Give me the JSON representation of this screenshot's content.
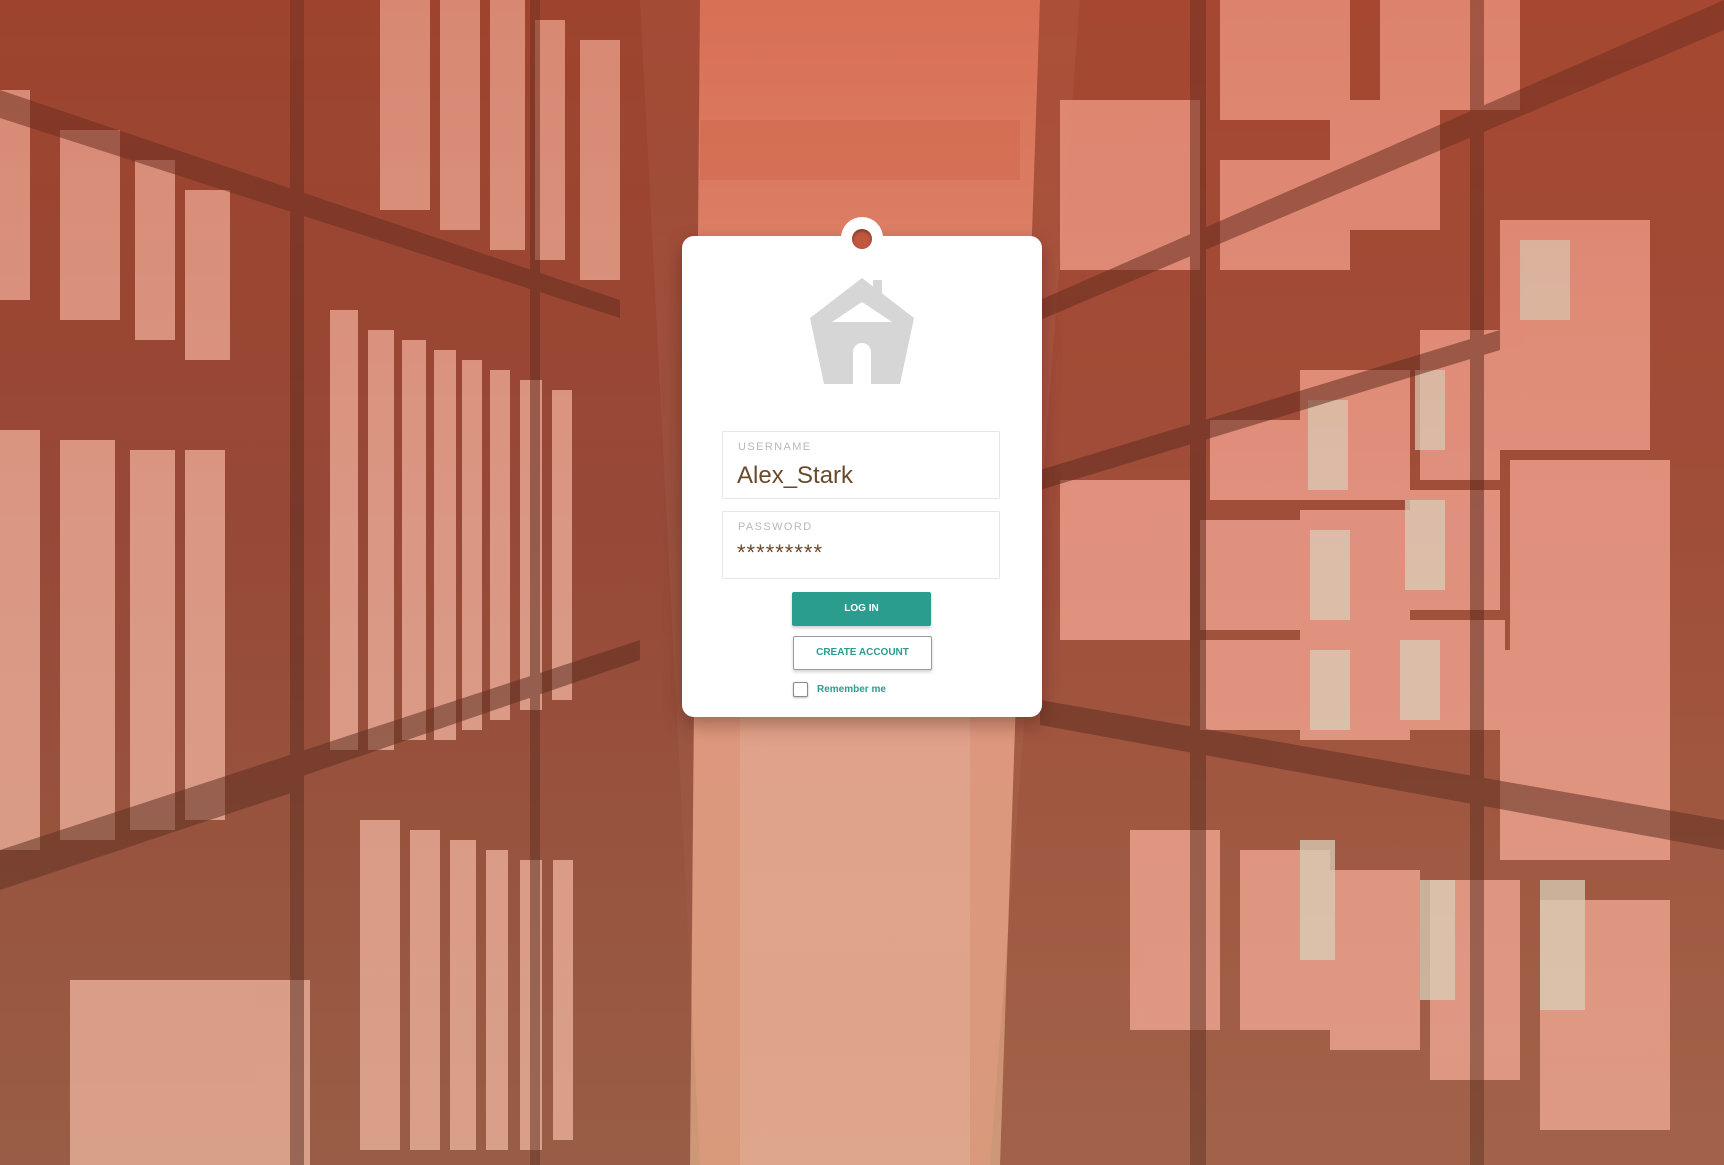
{
  "login_card": {
    "username_label": "USERNAME",
    "username_value": "Alex_Stark",
    "password_label": "PASSWORD",
    "password_value": "*********",
    "login_button": "LOG IN",
    "create_account_button": "CREATE ACCOUNT",
    "remember_me_label": "Remember me",
    "remember_me_checked": false,
    "logo_icon": "house-icon"
  },
  "colors": {
    "accent": "#2a9d8f",
    "input_text": "#6a4a2a",
    "label_text": "#b9b9b9",
    "background_tint": "#c96f58",
    "logo_gray": "#d6d6d6"
  }
}
